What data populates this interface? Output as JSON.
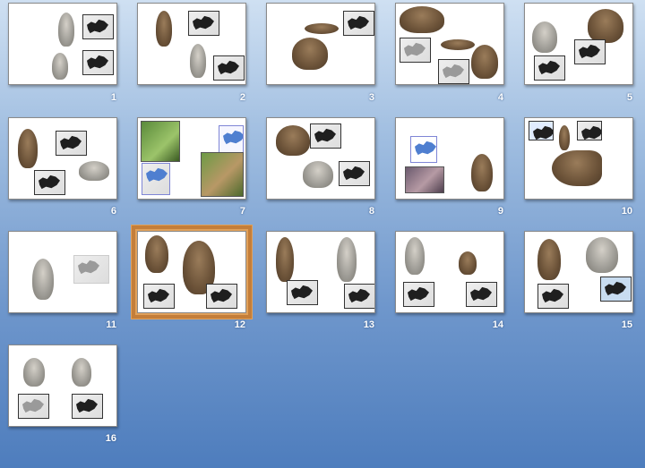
{
  "view": "slide-sorter",
  "selected_slide": 12,
  "colors": {
    "selection_border": "#c47e3a",
    "background_top": "#cfe0f2",
    "background_bottom": "#4e7dbd"
  },
  "slides": [
    {
      "number": "1"
    },
    {
      "number": "2"
    },
    {
      "number": "3"
    },
    {
      "number": "4"
    },
    {
      "number": "5"
    },
    {
      "number": "6"
    },
    {
      "number": "7"
    },
    {
      "number": "8"
    },
    {
      "number": "9"
    },
    {
      "number": "10"
    },
    {
      "number": "11"
    },
    {
      "number": "12"
    },
    {
      "number": "13"
    },
    {
      "number": "14"
    },
    {
      "number": "15"
    },
    {
      "number": "16"
    }
  ]
}
